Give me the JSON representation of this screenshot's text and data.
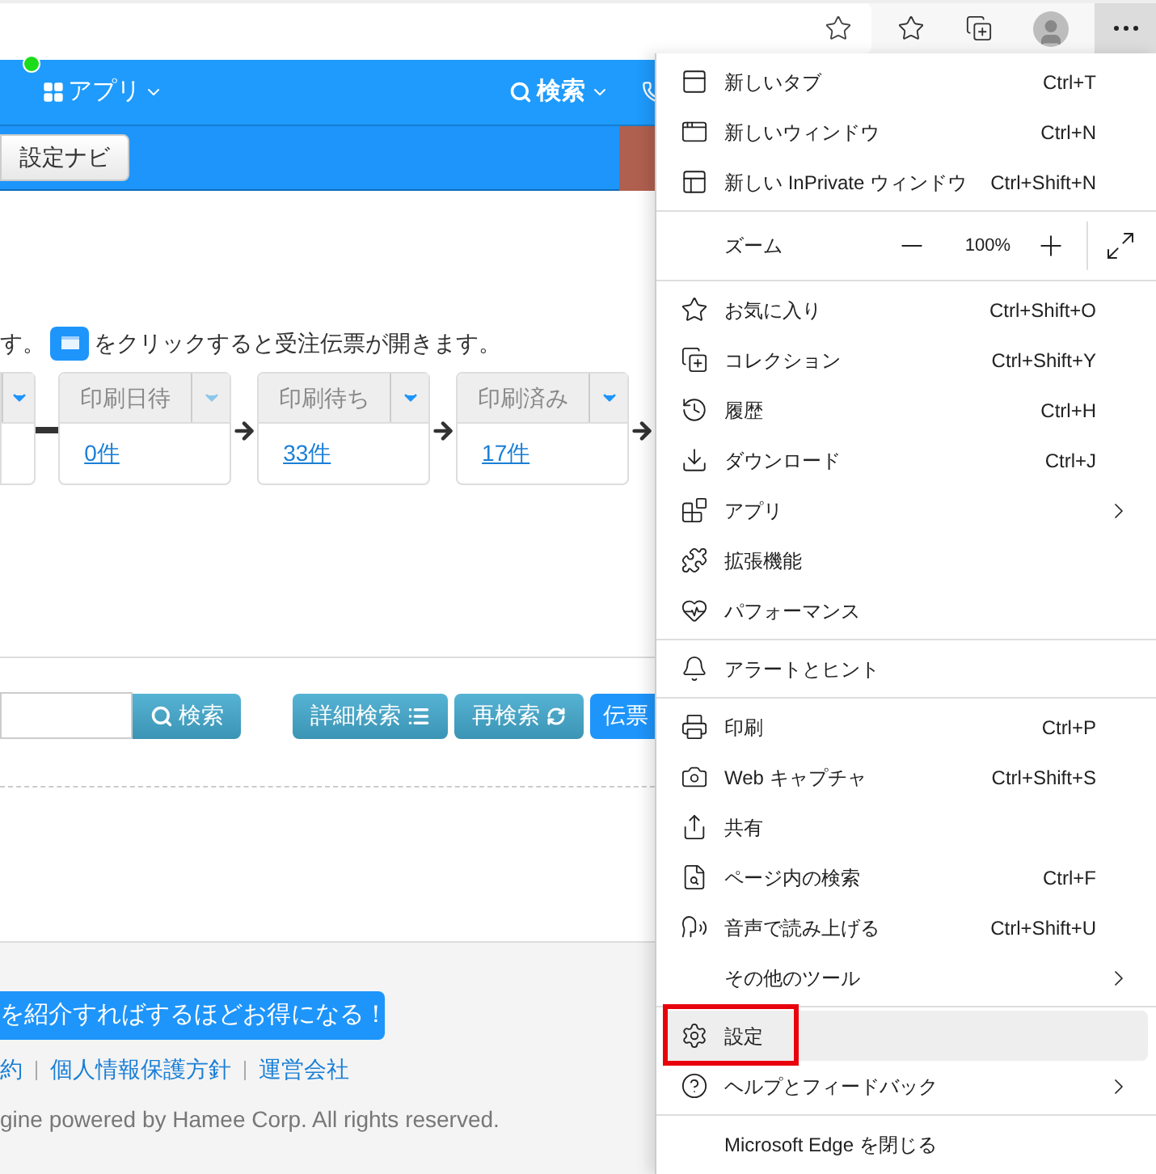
{
  "header": {
    "apps_label": "アプリ",
    "online": true,
    "search_label": "検索"
  },
  "subbar": {
    "nav_button": "設定ナビ"
  },
  "instruction": {
    "before": "す。",
    "after": "をクリックすると受注伝票が開きます。"
  },
  "flow": [
    {
      "kind": "box",
      "caret_disabled": false
    },
    {
      "kind": "line"
    },
    {
      "kind": "box",
      "label": "印刷日待",
      "count": "0件",
      "caret_disabled": true
    },
    {
      "kind": "arrow"
    },
    {
      "kind": "box",
      "label": "印刷待ち",
      "count": "33件",
      "caret_disabled": false
    },
    {
      "kind": "arrow"
    },
    {
      "kind": "box",
      "label": "印刷済み",
      "count": "17件",
      "caret_disabled": false
    },
    {
      "kind": "arrow"
    }
  ],
  "search": {
    "button": "検索",
    "detail_button": "詳細検索",
    "research_button": "再検索",
    "slip_button": "伝票"
  },
  "footer": {
    "banner": "を紹介すればするほどお得になる！",
    "links": [
      "約",
      "個人情報保護方針",
      "運営会社"
    ],
    "copyright": "gine powered by Hamee Corp. All rights reserved."
  },
  "menu": {
    "sections": [
      [
        {
          "label": "新しいタブ",
          "shortcut": "Ctrl+T",
          "selected": false,
          "boxed": false
        },
        {
          "label": "新しいウィンドウ",
          "shortcut": "Ctrl+N",
          "selected": false,
          "boxed": false
        },
        {
          "label": "新しい InPrivate ウィンドウ",
          "shortcut": "Ctrl+Shift+N",
          "selected": false,
          "boxed": false
        }
      ],
      [
        {
          "kind": "zoom",
          "label": "ズーム",
          "value": "100%"
        }
      ],
      [
        {
          "label": "お気に入り",
          "shortcut": "Ctrl+Shift+O",
          "selected": false,
          "boxed": false
        },
        {
          "label": "コレクション",
          "shortcut": "Ctrl+Shift+Y",
          "selected": false,
          "boxed": false
        },
        {
          "label": "履歴",
          "shortcut": "Ctrl+H",
          "selected": false,
          "boxed": false
        },
        {
          "label": "ダウンロード",
          "shortcut": "Ctrl+J",
          "selected": false,
          "boxed": false
        },
        {
          "label": "アプリ",
          "submenu": true,
          "selected": false,
          "boxed": false
        },
        {
          "label": "拡張機能",
          "selected": false,
          "boxed": false
        },
        {
          "label": "パフォーマンス",
          "selected": false,
          "boxed": false
        }
      ],
      [
        {
          "label": "アラートとヒント",
          "selected": false,
          "boxed": false
        }
      ],
      [
        {
          "label": "印刷",
          "shortcut": "Ctrl+P",
          "selected": false,
          "boxed": false
        },
        {
          "label": "Web キャプチャ",
          "shortcut": "Ctrl+Shift+S",
          "selected": false,
          "boxed": false
        },
        {
          "label": "共有",
          "selected": false,
          "boxed": false
        },
        {
          "label": "ページ内の検索",
          "shortcut": "Ctrl+F",
          "selected": false,
          "boxed": false
        },
        {
          "label": "音声で読み上げる",
          "shortcut": "Ctrl+Shift+U",
          "selected": false,
          "boxed": false
        },
        {
          "label": "その他のツール",
          "submenu": true,
          "selected": false,
          "boxed": false
        }
      ],
      [
        {
          "label": "設定",
          "selected": true,
          "boxed": true
        },
        {
          "label": "ヘルプとフィードバック",
          "submenu": true,
          "selected": false,
          "boxed": false
        }
      ],
      [
        {
          "label": "Microsoft Edge を閉じる",
          "selected": false,
          "boxed": false
        }
      ]
    ]
  }
}
